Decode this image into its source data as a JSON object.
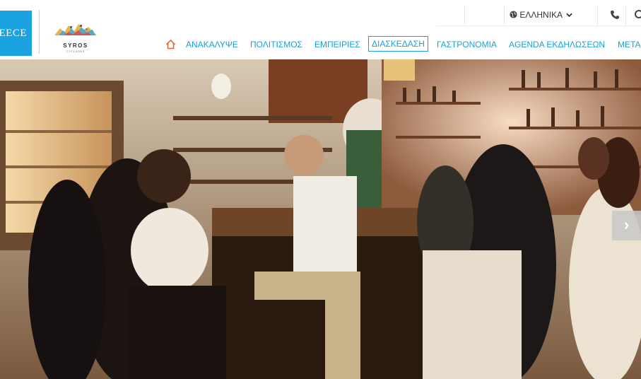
{
  "brand": {
    "text": "REECE"
  },
  "logo": {
    "name": "SYROS",
    "subtitle": "CYCLADES"
  },
  "utility": {
    "language": "ΕΛΛΗΝΙΚΑ"
  },
  "nav": {
    "items": [
      {
        "label": "ΑΝΑΚΑΛΥΨΕ"
      },
      {
        "label": "ΠΟΛΙΤΙΣΜΟΣ"
      },
      {
        "label": "ΕΜΠΕΙΡΙΕΣ"
      },
      {
        "label": "ΔΙΑΣΚΕΔΑΣΗ"
      },
      {
        "label": "ΓΑΣΤΡΟΝΟΜΙΑ"
      },
      {
        "label": "AGENDA ΕΚΔΗΛΩΣΕΩΝ"
      },
      {
        "label": "ΜΕΤΑ"
      }
    ]
  },
  "colors": {
    "accent": "#1aa0d8",
    "brand_blue": "#1aa3e0"
  },
  "icons": [
    "home-icon",
    "globe-icon",
    "chevron-down-icon",
    "phone-icon",
    "search-icon",
    "chevron-right-icon"
  ],
  "carousel": {
    "next_label": "›"
  }
}
